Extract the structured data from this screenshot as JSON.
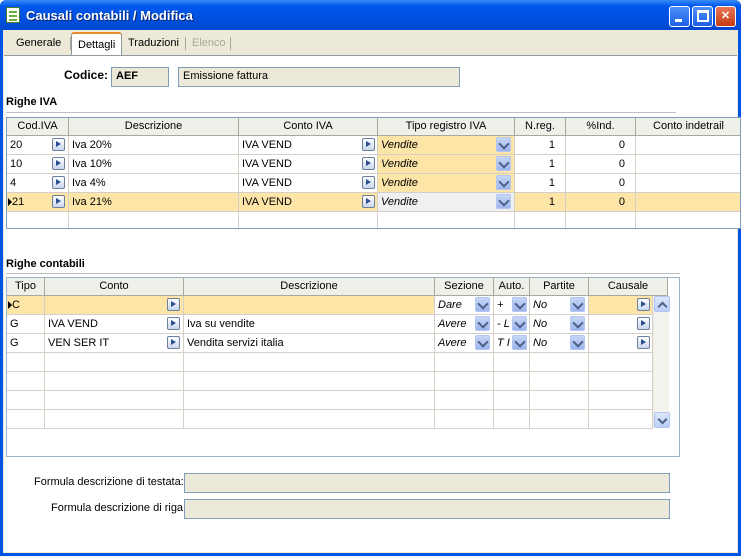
{
  "window": {
    "title": "Causali contabili / Modifica"
  },
  "tabs": [
    {
      "label": "Generale",
      "state": "normal"
    },
    {
      "label": "Dettagli",
      "state": "active"
    },
    {
      "label": "Traduzioni",
      "state": "normal"
    },
    {
      "label": "Elenco",
      "state": "disabled"
    }
  ],
  "header": {
    "codice_label": "Codice:",
    "codice_value": "AEF",
    "descrizione_value": "Emissione fattura"
  },
  "righe_iva": {
    "title": "Righe IVA",
    "columns": [
      "Cod.IVA",
      "Descrizione",
      "Conto IVA",
      "Tipo registro IVA",
      "N.reg.",
      "%Ind.",
      "Conto indetrail"
    ],
    "rows": [
      {
        "cod": "20",
        "desc": "Iva 20%",
        "conto": "IVA VEND",
        "tipo": "Vendite",
        "nreg": "1",
        "ind": "0"
      },
      {
        "cod": "10",
        "desc": "Iva 10%",
        "conto": "IVA VEND",
        "tipo": "Vendite",
        "nreg": "1",
        "ind": "0"
      },
      {
        "cod": "4",
        "desc": "Iva 4%",
        "conto": "IVA VEND",
        "tipo": "Vendite",
        "nreg": "1",
        "ind": "0"
      },
      {
        "cod": "21",
        "desc": "Iva 21%",
        "conto": "IVA VEND",
        "tipo": "Vendite",
        "nreg": "1",
        "ind": "0"
      }
    ]
  },
  "righe_contabili": {
    "title": "Righe contabili",
    "columns": [
      "Tipo",
      "Conto",
      "Descrizione",
      "Sezione",
      "Auto.",
      "Partite",
      "Causale"
    ],
    "rows": [
      {
        "tipo": "C",
        "conto": "",
        "desc": "",
        "sezione": "Dare",
        "auto": "+",
        "partite": "No"
      },
      {
        "tipo": "G",
        "conto": "IVA VEND",
        "desc": "Iva su vendite",
        "sezione": "Avere",
        "auto": "- L",
        "partite": "No"
      },
      {
        "tipo": "G",
        "conto": "VEN SER IT",
        "desc": "Vendita servizi italia",
        "sezione": "Avere",
        "auto": "T I",
        "partite": "No"
      }
    ]
  },
  "formula": {
    "testata_label": "Formula descrizione di testata:",
    "riga_label": "Formula descrizione di riga:",
    "testata_value": "",
    "riga_value": ""
  },
  "colors": {
    "selected_row": "#fde5a8",
    "titlebar": "#0054e3"
  }
}
